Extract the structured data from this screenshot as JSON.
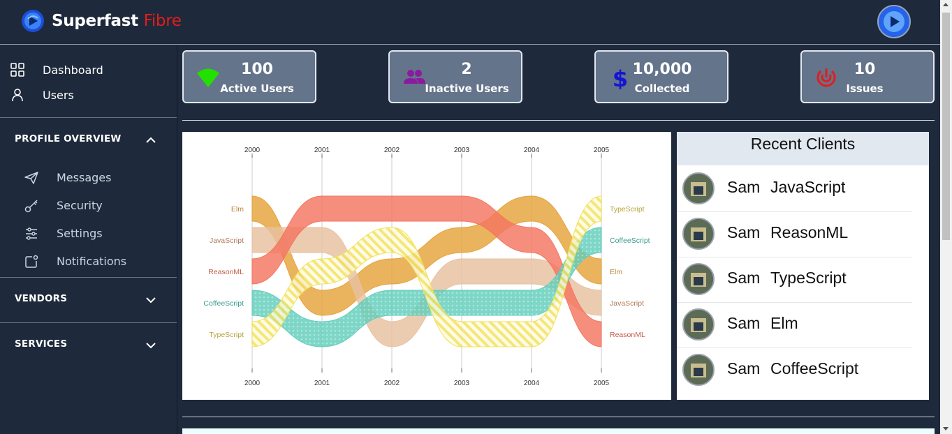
{
  "brand": {
    "name": "Superfast",
    "accent": "Fibre"
  },
  "sidebar": {
    "items": [
      {
        "label": "Dashboard",
        "icon": "grid-icon"
      },
      {
        "label": "Users",
        "icon": "user-icon"
      }
    ],
    "sections": [
      {
        "label": "PROFILE OVERVIEW",
        "expanded": true,
        "items": [
          {
            "label": "Messages",
            "icon": "paper-plane-icon"
          },
          {
            "label": "Security",
            "icon": "key-icon"
          },
          {
            "label": "Settings",
            "icon": "sliders-icon"
          },
          {
            "label": "Notifications",
            "icon": "notification-icon"
          }
        ]
      },
      {
        "label": "VENDORS",
        "expanded": false
      },
      {
        "label": "SERVICES",
        "expanded": false
      }
    ]
  },
  "stats": [
    {
      "value": "100",
      "caption": "Active Users",
      "icon": "wifi-icon",
      "color": "#22e000"
    },
    {
      "value": "2",
      "caption": "Inactive Users",
      "icon": "users-icon",
      "color": "#8b1a9e"
    },
    {
      "value": "10,000",
      "caption": "Collected",
      "icon": "dollar-icon",
      "color": "#1414d4"
    },
    {
      "value": "10",
      "caption": "Issues",
      "icon": "target-icon",
      "color": "#e11d1d"
    }
  ],
  "chart_data": {
    "type": "bump",
    "x": [
      "2000",
      "2001",
      "2002",
      "2003",
      "2004",
      "2005"
    ],
    "series": [
      {
        "name": "Elm",
        "ranks": [
          1,
          4,
          3,
          2,
          1,
          3
        ],
        "color": "#e5a33a"
      },
      {
        "name": "JavaScript",
        "ranks": [
          2,
          2,
          5,
          3,
          3,
          4
        ],
        "color": "#e8c1a0"
      },
      {
        "name": "ReasonML",
        "ranks": [
          3,
          1,
          1,
          1,
          2,
          5
        ],
        "color": "#f47560"
      },
      {
        "name": "CoffeeScript",
        "ranks": [
          4,
          5,
          4,
          4,
          4,
          2
        ],
        "color": "#61cdbb"
      },
      {
        "name": "TypeScript",
        "ranks": [
          5,
          3,
          2,
          5,
          5,
          1
        ],
        "color": "#f1e15b"
      }
    ]
  },
  "clients": {
    "title": "Recent Clients",
    "rows": [
      {
        "name": "Sam",
        "lang": "JavaScript"
      },
      {
        "name": "Sam",
        "lang": "ReasonML"
      },
      {
        "name": "Sam",
        "lang": "TypeScript"
      },
      {
        "name": "Sam",
        "lang": "Elm"
      },
      {
        "name": "Sam",
        "lang": "CoffeeScript"
      }
    ]
  }
}
